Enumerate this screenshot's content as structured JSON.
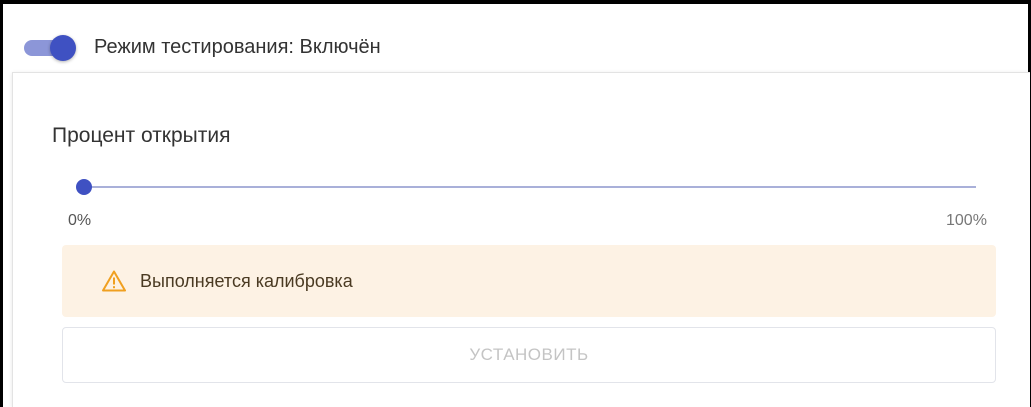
{
  "testing_mode": {
    "label": "Режим тестирования: Включён",
    "enabled": true,
    "accent_color": "#3f51c2"
  },
  "opening": {
    "title": "Процент открытия",
    "slider_value_percent": 0,
    "min_label": "0%",
    "max_label": "100%"
  },
  "alert": {
    "icon": "warning-triangle-icon",
    "text": "Выполняется калибровка",
    "background_color": "#fdf2e4",
    "icon_color": "#f0a020"
  },
  "actions": {
    "set_label": "УСТАНОВИТЬ",
    "set_disabled": true
  }
}
